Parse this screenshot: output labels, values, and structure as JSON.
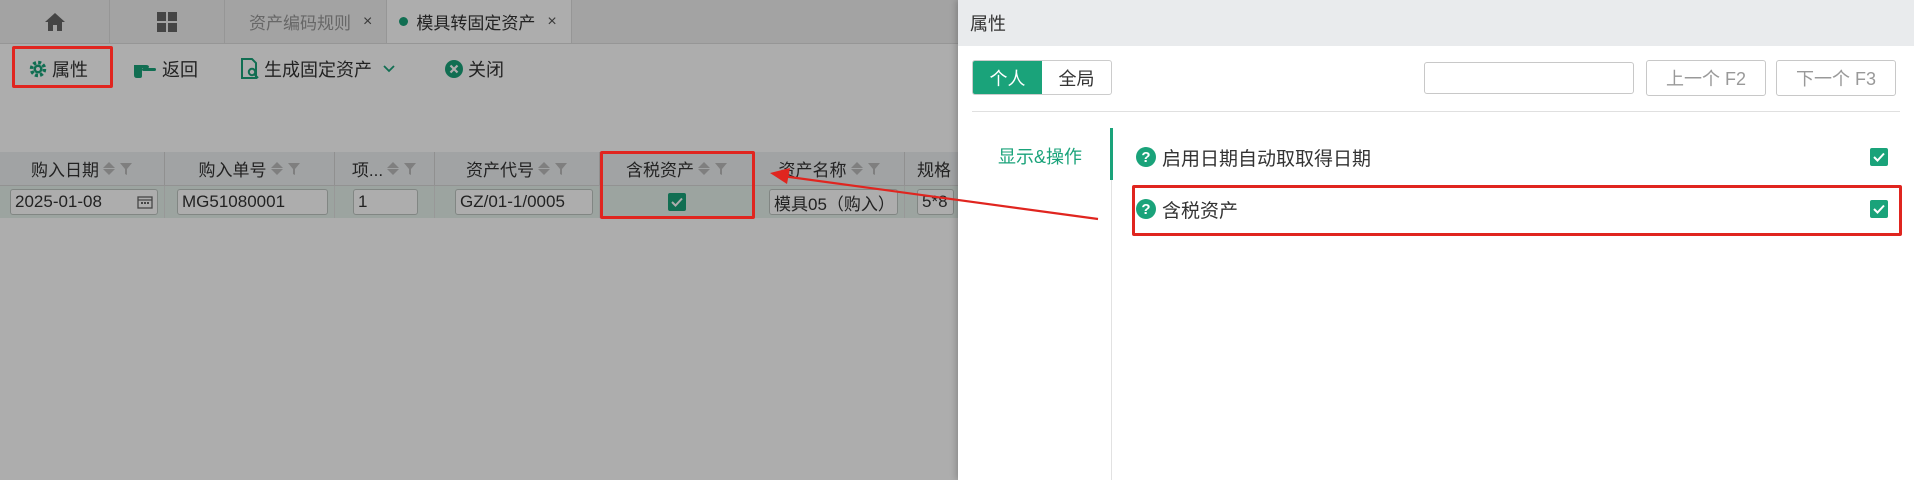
{
  "tabs": [
    {
      "label": "资产编码规则",
      "close": "×",
      "active": false
    },
    {
      "label": "模具转固定资产",
      "close": "×",
      "active": true
    }
  ],
  "toolbar": {
    "properties": "属性",
    "back": "返回",
    "generate": "生成固定资产",
    "close": "关闭"
  },
  "grid": {
    "columns": [
      "购入日期",
      "购入单号",
      "项...",
      "资产代号",
      "含税资产",
      "资产名称",
      "规格"
    ],
    "row": {
      "date": "2025-01-08",
      "order_no": "MG51080001",
      "item": "1",
      "asset_code": "GZ/01-1/0005",
      "tax_included": true,
      "asset_name": "模具05（购入）",
      "spec": "5*8"
    }
  },
  "dialog": {
    "title": "属性",
    "scope_tabs": [
      "个人",
      "全局"
    ],
    "active_scope": "个人",
    "search_placeholder": "",
    "prev_button": "上一个 F2",
    "next_button": "下一个 F3",
    "side_tab": "显示&操作",
    "properties": [
      {
        "label": "启用日期自动取取得日期",
        "checked": true
      },
      {
        "label": "含税资产",
        "checked": true
      }
    ]
  },
  "colors": {
    "accent": "#1aa37a",
    "highlight": "#e0251f"
  }
}
